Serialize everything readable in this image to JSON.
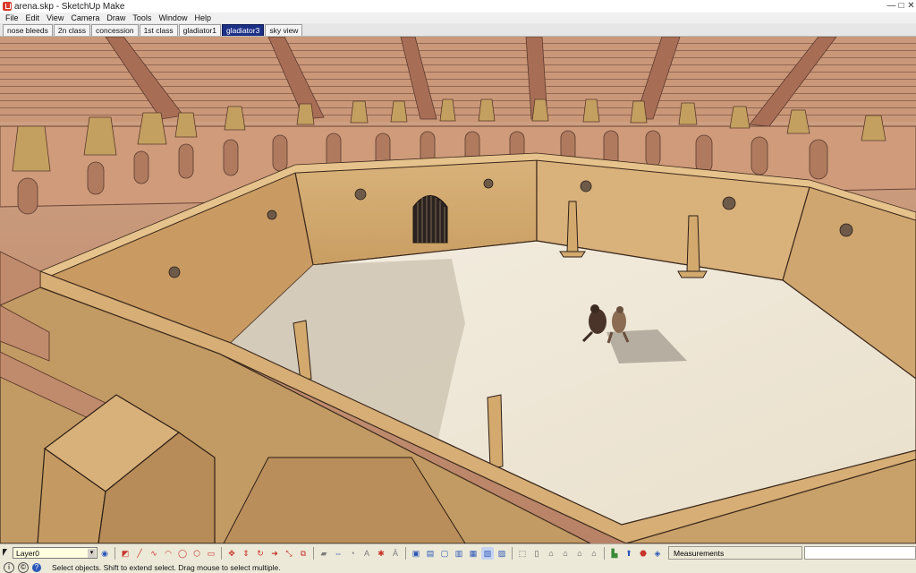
{
  "window": {
    "title": "arena.skp - SketchUp Make",
    "app_icon": "sketchup-icon",
    "controls": [
      "—",
      "□",
      "✕"
    ]
  },
  "menu": [
    "File",
    "Edit",
    "View",
    "Camera",
    "Draw",
    "Tools",
    "Window",
    "Help"
  ],
  "scenes": {
    "tabs": [
      "nose bleeds",
      "2n class",
      "concession",
      "1st class",
      "gladiator1",
      "gladiator3",
      "sky view"
    ],
    "active_index": 5
  },
  "toolbar": {
    "layer_value": "Layer0",
    "dropdown_glyph": "▾",
    "measurements_label": "Measurements",
    "groups": [
      [
        "select-icon",
        "component-icon",
        "paint-icon",
        "eraser-icon",
        "tape-icon"
      ],
      [
        "line-icon",
        "freehand-icon",
        "arc-icon",
        "circle-icon",
        "polygon-icon",
        "rectangle-icon"
      ],
      [
        "move-icon",
        "pushpull-icon",
        "rotate-icon",
        "followme-icon",
        "scale-icon",
        "offset-icon"
      ],
      [
        "tape-measure-icon",
        "dimension-icon",
        "protractor-icon",
        "text-icon",
        "axes-icon",
        "3dtext-icon"
      ],
      [
        "xray-icon",
        "backedges-icon",
        "wireframe-icon",
        "hiddenline-icon",
        "shaded-icon",
        "textured-icon",
        "monochrome-icon"
      ],
      [
        "iso-icon",
        "top-icon",
        "front-icon",
        "right-icon",
        "back-icon",
        "left-icon"
      ],
      [
        "warehouse-icon",
        "share-icon",
        "extension-icon",
        "3dwarehouse-icon"
      ]
    ],
    "colors": {
      "red": "#c8342a",
      "blue": "#2a56b8",
      "green": "#3a8a3a",
      "gray": "#7b7b7b"
    }
  },
  "status": {
    "text": "Select objects. Shift to extend select. Drag mouse to select multiple.",
    "icons": [
      "geo-location-icon",
      "credits-icon",
      "help-icon"
    ]
  }
}
